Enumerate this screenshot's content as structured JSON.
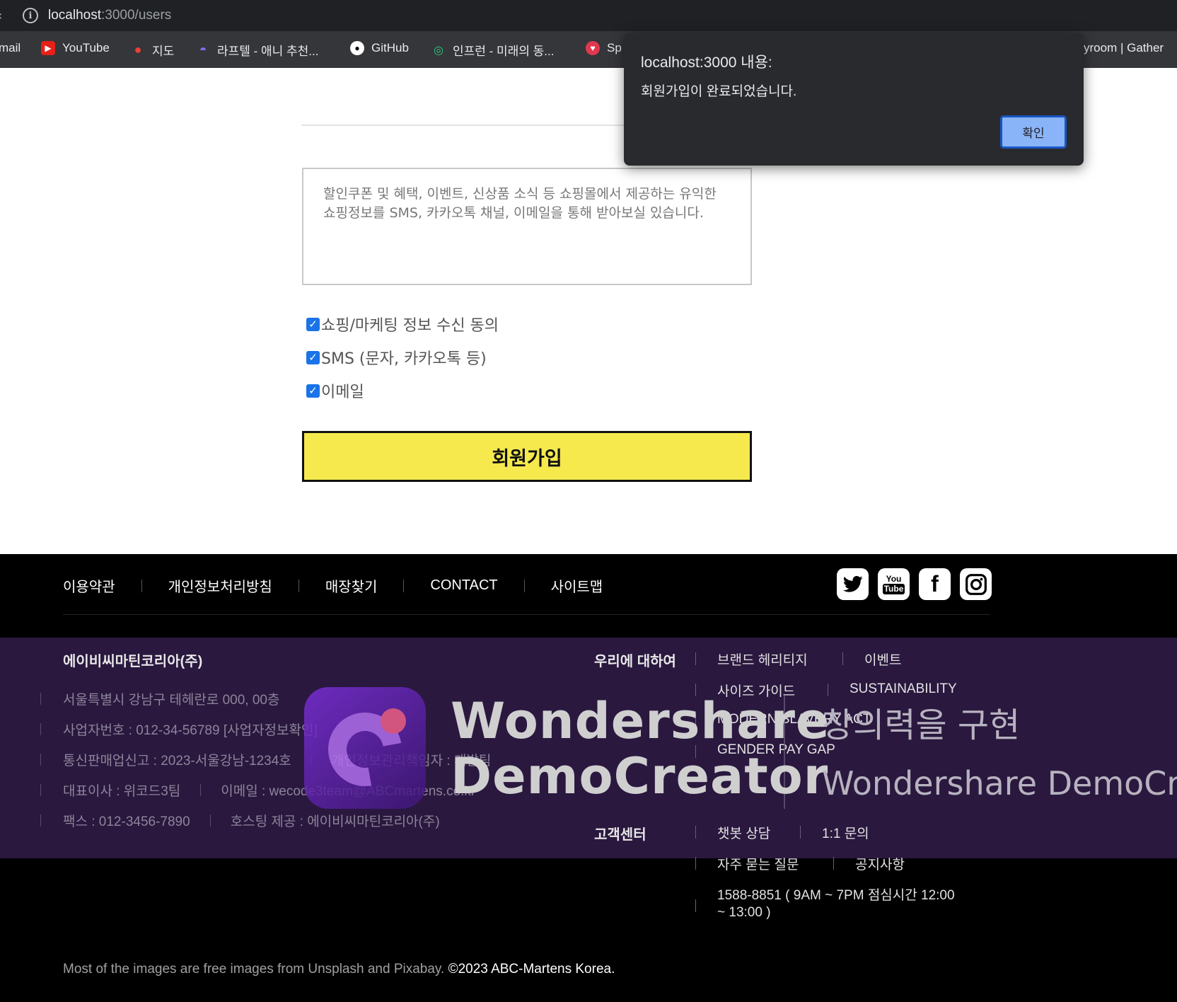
{
  "browser": {
    "url_host": "localhost",
    "url_path": ":3000/users",
    "bookmarks": [
      {
        "label": "mail",
        "icon": "gmail-icon"
      },
      {
        "label": "YouTube",
        "icon": "youtube-icon"
      },
      {
        "label": "지도",
        "icon": "maps-icon"
      },
      {
        "label": "라프텔 - 애니 추천...",
        "icon": "laftel-icon"
      },
      {
        "label": "GitHub",
        "icon": "github-icon"
      },
      {
        "label": "인프런 - 미래의 동...",
        "icon": "inflearn-icon"
      },
      {
        "label": "Sp",
        "icon": "bookmark-icon"
      },
      {
        "label": "yroom | Gather",
        "icon": "none"
      }
    ]
  },
  "signup": {
    "terms_text": "할인쿠폰 및 혜택, 이벤트, 신상품 소식 등 쇼핑몰에서 제공하는 유익한 쇼핑정보를 SMS, 카카오톡 채널, 이메일을 통해 받아보실 있습니다.",
    "checkboxes": [
      {
        "label": "쇼핑/마케팅 정보 수신 동의",
        "checked": true
      },
      {
        "label": "SMS (문자, 카카오톡 등)",
        "checked": true
      },
      {
        "label": "이메일",
        "checked": true
      }
    ],
    "submit_label": "회원가입"
  },
  "footer": {
    "nav": [
      "이용약관",
      "개인정보처리방침",
      "매장찾기",
      "CONTACT",
      "사이트맵"
    ],
    "social": [
      "twitter-icon",
      "youtube-icon",
      "facebook-icon",
      "instagram-icon"
    ],
    "company": "에이비씨마틴코리아(주)",
    "address": "서울특별시 강남구 테헤란로 000, 00층",
    "biz_number": "사업자번호 : 012-34-56789 [사업자정보확인]",
    "mail_order": "통신판매업신고 : 2023-서울강남-1234호",
    "privacy_officer": "개인정보관리책임자 : 개발팀",
    "ceo": "대표이사 : 위코드3팀",
    "email": "이메일 : wecode3team@ABCmartens.co.kr",
    "fax": "팩스 : 012-3456-7890",
    "hosting": "호스팅 제공 : 에이비씨마틴코리아(주)",
    "about_title": "우리에 대하여",
    "about_links": [
      "브랜드 헤리티지",
      "이벤트",
      "사이즈 가이드",
      "SUSTAINABILITY",
      "MODERN SLAVERY ACT",
      "GENDER PAY GAP"
    ],
    "cs_title": "고객센터",
    "cs_links": [
      "챗봇 상담",
      "1:1 문의",
      "자주 묻는 질문",
      "공지사항"
    ],
    "cs_phone_line1": "1588-8851 ( 9AM ~ 7PM 점심시간 12:00",
    "cs_phone_line2": "~ 13:00 )",
    "copyright_prefix": "Most of the images are free images from Unsplash and Pixabay.",
    "copyright_brand": "©2023 ABC-Martens Korea."
  },
  "watermark": {
    "line1": "Wondershare",
    "line2": "DemoCreator",
    "side1": "창의력을 구현",
    "side2": "Wondershare DemoCr"
  },
  "dialog": {
    "title": "localhost:3000 내용:",
    "message": "회원가입이 완료되었습니다.",
    "ok_label": "확인"
  }
}
